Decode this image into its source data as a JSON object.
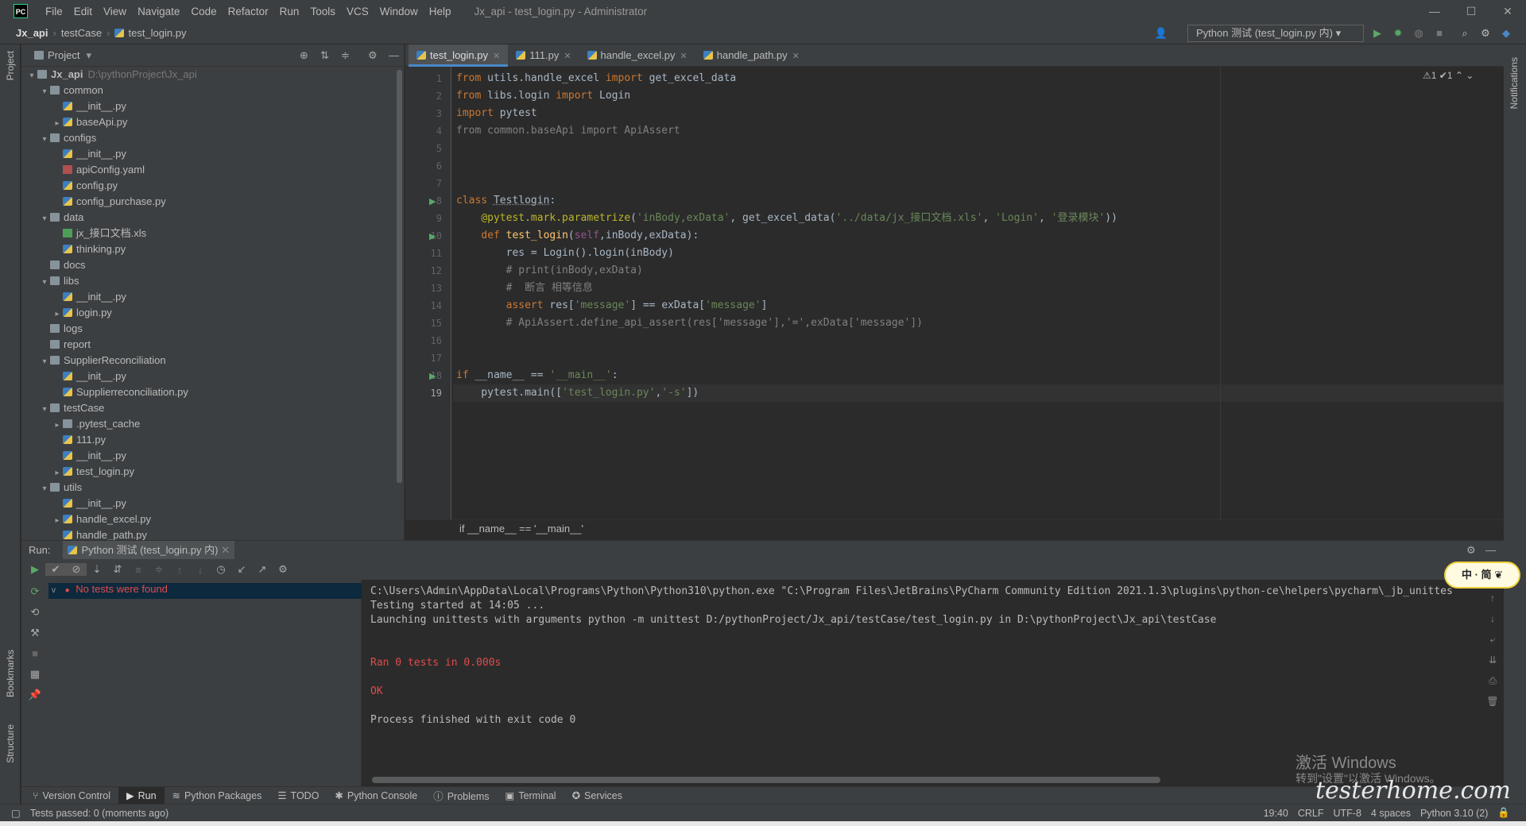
{
  "app": {
    "logo": "PC",
    "window_title": "Jx_api - test_login.py - Administrator",
    "menu": [
      "File",
      "Edit",
      "View",
      "Navigate",
      "Code",
      "Refactor",
      "Run",
      "Tools",
      "VCS",
      "Window",
      "Help"
    ],
    "controls": [
      "—",
      "☐",
      "✕"
    ]
  },
  "nav": {
    "crumbs": [
      "Jx_api",
      "testCase",
      "test_login.py"
    ],
    "run_config": "Python 测试 (test_login.py 内)"
  },
  "project": {
    "title": "Project",
    "tree": [
      {
        "label": "Jx_api",
        "path": "D:\\pythonProject\\Jx_api",
        "indent": 0,
        "arrow": "v",
        "type": "folder"
      },
      {
        "label": "common",
        "indent": 1,
        "arrow": "v",
        "type": "folder"
      },
      {
        "label": "__init__.py",
        "indent": 2,
        "arrow": "",
        "type": "py"
      },
      {
        "label": "baseApi.py",
        "indent": 2,
        "arrow": ">",
        "type": "py"
      },
      {
        "label": "configs",
        "indent": 1,
        "arrow": "v",
        "type": "folder"
      },
      {
        "label": "__init__.py",
        "indent": 2,
        "arrow": "",
        "type": "py"
      },
      {
        "label": "apiConfig.yaml",
        "indent": 2,
        "arrow": "",
        "type": "yaml"
      },
      {
        "label": "config.py",
        "indent": 2,
        "arrow": "",
        "type": "py"
      },
      {
        "label": "config_purchase.py",
        "indent": 2,
        "arrow": "",
        "type": "py"
      },
      {
        "label": "data",
        "indent": 1,
        "arrow": "v",
        "type": "folder"
      },
      {
        "label": "jx_接口文档.xls",
        "indent": 2,
        "arrow": "",
        "type": "xls"
      },
      {
        "label": "thinking.py",
        "indent": 2,
        "arrow": "",
        "type": "py"
      },
      {
        "label": "docs",
        "indent": 1,
        "arrow": "",
        "type": "folder"
      },
      {
        "label": "libs",
        "indent": 1,
        "arrow": "v",
        "type": "folder"
      },
      {
        "label": "__init__.py",
        "indent": 2,
        "arrow": "",
        "type": "py"
      },
      {
        "label": "login.py",
        "indent": 2,
        "arrow": ">",
        "type": "py"
      },
      {
        "label": "logs",
        "indent": 1,
        "arrow": "",
        "type": "folder"
      },
      {
        "label": "report",
        "indent": 1,
        "arrow": "",
        "type": "folder"
      },
      {
        "label": "SupplierReconciliation",
        "indent": 1,
        "arrow": "v",
        "type": "folder"
      },
      {
        "label": "__init__.py",
        "indent": 2,
        "arrow": "",
        "type": "py"
      },
      {
        "label": "Supplierreconciliation.py",
        "indent": 2,
        "arrow": "",
        "type": "py"
      },
      {
        "label": "testCase",
        "indent": 1,
        "arrow": "v",
        "type": "folder"
      },
      {
        "label": ".pytest_cache",
        "indent": 2,
        "arrow": ">",
        "type": "folder"
      },
      {
        "label": "111.py",
        "indent": 2,
        "arrow": "",
        "type": "py"
      },
      {
        "label": "__init__.py",
        "indent": 2,
        "arrow": "",
        "type": "py"
      },
      {
        "label": "test_login.py",
        "indent": 2,
        "arrow": ">",
        "type": "py"
      },
      {
        "label": "utils",
        "indent": 1,
        "arrow": "v",
        "type": "folder"
      },
      {
        "label": "__init__.py",
        "indent": 2,
        "arrow": "",
        "type": "py"
      },
      {
        "label": "handle_excel.py",
        "indent": 2,
        "arrow": ">",
        "type": "py"
      },
      {
        "label": "handle_path.py",
        "indent": 2,
        "arrow": "",
        "type": "py"
      }
    ]
  },
  "tabs": [
    {
      "label": "test_login.py",
      "active": true
    },
    {
      "label": "111.py"
    },
    {
      "label": "handle_excel.py"
    },
    {
      "label": "handle_path.py"
    }
  ],
  "editor": {
    "lines": [
      [
        [
          "kw",
          "from "
        ],
        [
          "",
          "utils.handle_excel "
        ],
        [
          "kw",
          "import "
        ],
        [
          "",
          "get_excel_data"
        ]
      ],
      [
        [
          "kw",
          "from "
        ],
        [
          "",
          "libs.login "
        ],
        [
          "kw",
          "import "
        ],
        [
          "",
          "Login"
        ]
      ],
      [
        [
          "kw",
          "import "
        ],
        [
          "",
          "pytest"
        ]
      ],
      [
        [
          "cm",
          "from common.baseApi import ApiAssert"
        ]
      ],
      [],
      [],
      [],
      [
        [
          "kw",
          "class "
        ],
        [
          "cls",
          "Testlogin"
        ],
        [
          "",
          ":"
        ]
      ],
      [
        [
          "",
          "    "
        ],
        [
          "dec",
          "@pytest.mark.parametrize"
        ],
        [
          "",
          "("
        ],
        [
          "str",
          "'inBody,exData'"
        ],
        [
          "",
          ", get_excel_data("
        ],
        [
          "str",
          "'../data/jx_接口文档.xls'"
        ],
        [
          "",
          ", "
        ],
        [
          "str",
          "'Login'"
        ],
        [
          "",
          ", "
        ],
        [
          "str",
          "'登录模块'"
        ],
        [
          "",
          "))"
        ]
      ],
      [
        [
          "",
          "    "
        ],
        [
          "kw",
          "def "
        ],
        [
          "fn",
          "test_login"
        ],
        [
          "",
          "("
        ],
        [
          "self",
          "self"
        ],
        [
          "",
          ",inBody,exData):"
        ]
      ],
      [
        [
          "",
          "        res = Login().login(inBody)"
        ]
      ],
      [
        [
          "cm",
          "        # print(inBody,exData)"
        ]
      ],
      [
        [
          "cm",
          "        #  断言 相等信息"
        ]
      ],
      [
        [
          "",
          "        "
        ],
        [
          "kw",
          "assert "
        ],
        [
          "",
          "res["
        ],
        [
          "str",
          "'message'"
        ],
        [
          "",
          "] == exData["
        ],
        [
          "str",
          "'message'"
        ],
        [
          "",
          "]"
        ]
      ],
      [
        [
          "cm",
          "        # ApiAssert.define_api_assert(res['message'],'=',exData['message'])"
        ]
      ],
      [],
      [],
      [
        [
          "kw",
          "if "
        ],
        [
          "",
          "__name__ == "
        ],
        [
          "str",
          "'__main__'"
        ],
        [
          "",
          ":"
        ]
      ],
      [
        [
          "",
          "    pytest.main(["
        ],
        [
          "str",
          "'test_login.py'"
        ],
        [
          "",
          ","
        ],
        [
          "str",
          "'-s'"
        ],
        [
          "",
          "])"
        ]
      ]
    ],
    "current_line": 19,
    "run_markers": [
      8,
      10,
      18
    ],
    "breadcrumb": "if __name__ == '__main__'",
    "inspections": "⚠1 ✔1 ⌃ ⌄"
  },
  "run": {
    "label": "Run:",
    "config": "Python 测试 (test_login.py 内)",
    "result": "No tests were found",
    "output": [
      {
        "text": "C:\\Users\\Admin\\AppData\\Local\\Programs\\Python\\Python310\\python.exe \"C:\\Program Files\\JetBrains\\PyCharm Community Edition 2021.1.3\\plugins\\python-ce\\helpers\\pycharm\\_jb_unittes",
        "cls": ""
      },
      {
        "text": "Testing started at 14:05 ...",
        "cls": ""
      },
      {
        "text": "Launching unittests with arguments python -m unittest D:/pythonProject/Jx_api/testCase/test_login.py in D:\\pythonProject\\Jx_api\\testCase",
        "cls": ""
      },
      {
        "text": "",
        "cls": ""
      },
      {
        "text": "",
        "cls": ""
      },
      {
        "text": "Ran 0 tests in 0.000s",
        "cls": "red"
      },
      {
        "text": "",
        "cls": ""
      },
      {
        "text": "OK",
        "cls": "red"
      },
      {
        "text": "",
        "cls": ""
      },
      {
        "text": "Process finished with exit code 0",
        "cls": ""
      }
    ]
  },
  "bottom_tabs": [
    {
      "icon": "⑂",
      "label": "Version Control"
    },
    {
      "icon": "▶",
      "label": "Run",
      "active": true
    },
    {
      "icon": "≋",
      "label": "Python Packages"
    },
    {
      "icon": "☰",
      "label": "TODO"
    },
    {
      "icon": "✱",
      "label": "Python Console"
    },
    {
      "icon": "ⓘ",
      "label": "Problems"
    },
    {
      "icon": "▣",
      "label": "Terminal"
    },
    {
      "icon": "✪",
      "label": "Services"
    }
  ],
  "status": {
    "left": "Tests passed: 0 (moments ago)",
    "right": [
      "19:40",
      "CRLF",
      "UTF-8",
      "4 spaces",
      "Python 3.10 (2)"
    ]
  },
  "side": {
    "project": "Project",
    "bookmarks": "Bookmarks",
    "structure": "Structure",
    "notifications": "Notifications"
  },
  "overlay": {
    "activate1": "激活 Windows",
    "activate2": "转到\"设置\"以激活 Windows。",
    "site": "testerhome.com",
    "badge": "中 · 简 ❦"
  }
}
